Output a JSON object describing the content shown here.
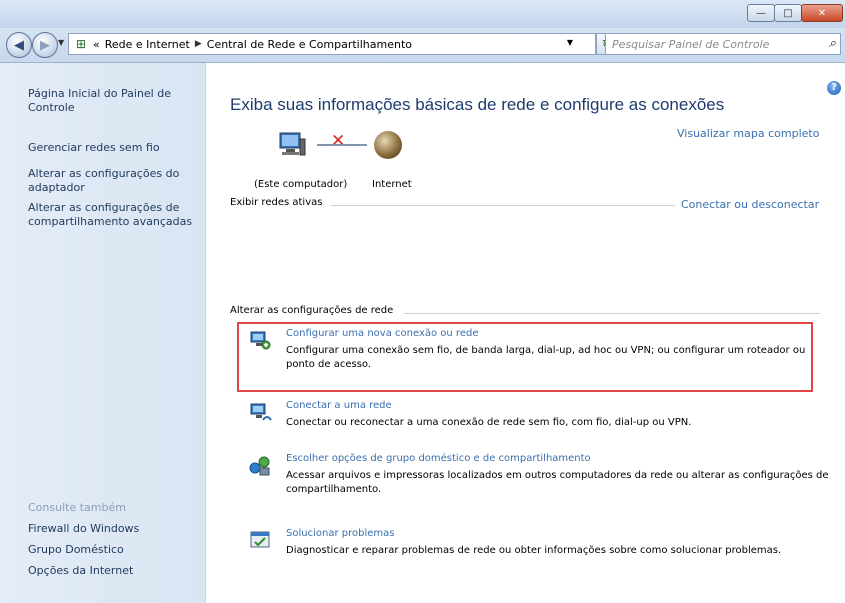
{
  "window": {
    "controls": {
      "minimize": "—",
      "maximize": "□",
      "close": "✕"
    }
  },
  "address_bar": {
    "prefix": "«",
    "crumbs": [
      "Rede e Internet",
      "Central de Rede e Compartilhamento"
    ],
    "search_placeholder": "Pesquisar Painel de Controle"
  },
  "sidebar": {
    "links": [
      "Página Inicial do Painel de Controle",
      "Gerenciar redes sem fio",
      "Alterar as configurações do adaptador",
      "Alterar as configurações de compartilhamento avançadas"
    ],
    "see_also_label": "Consulte também",
    "see_also": [
      "Firewall do Windows",
      "Grupo Doméstico",
      "Opções da Internet"
    ]
  },
  "main": {
    "title": "Exiba suas informações básicas de rede e configure as conexões",
    "full_map_link": "Visualizar mapa completo",
    "map": {
      "computer_label": "(Este computador)",
      "internet_label": "Internet"
    },
    "active_networks_header": "Exibir redes ativas",
    "connect_link": "Conectar ou desconectar",
    "change_settings_header": "Alterar as configurações de rede",
    "tasks": [
      {
        "title": "Configurar uma nova conexão ou rede",
        "description": "Configurar uma conexão sem fio, de banda larga, dial-up, ad hoc ou VPN; ou configurar um roteador ou ponto de acesso.",
        "icon": "network-setup-icon"
      },
      {
        "title": "Conectar a uma rede",
        "description": "Conectar ou reconectar a uma conexão de rede sem fio, com fio, dial-up ou VPN.",
        "icon": "connect-network-icon"
      },
      {
        "title": "Escolher opções de grupo doméstico e de compartilhamento",
        "description": "Acessar arquivos e impressoras localizados em outros computadores da rede ou alterar as configurações de compartilhamento.",
        "icon": "homegroup-icon"
      },
      {
        "title": "Solucionar problemas",
        "description": "Diagnosticar e reparar problemas de rede ou obter informações sobre como solucionar problemas.",
        "icon": "troubleshoot-icon"
      }
    ]
  },
  "colors": {
    "link": "#3a6fb0",
    "title": "#1e3c6c",
    "highlight_border": "#e24646",
    "disconnected_x": "#d42a2a"
  }
}
